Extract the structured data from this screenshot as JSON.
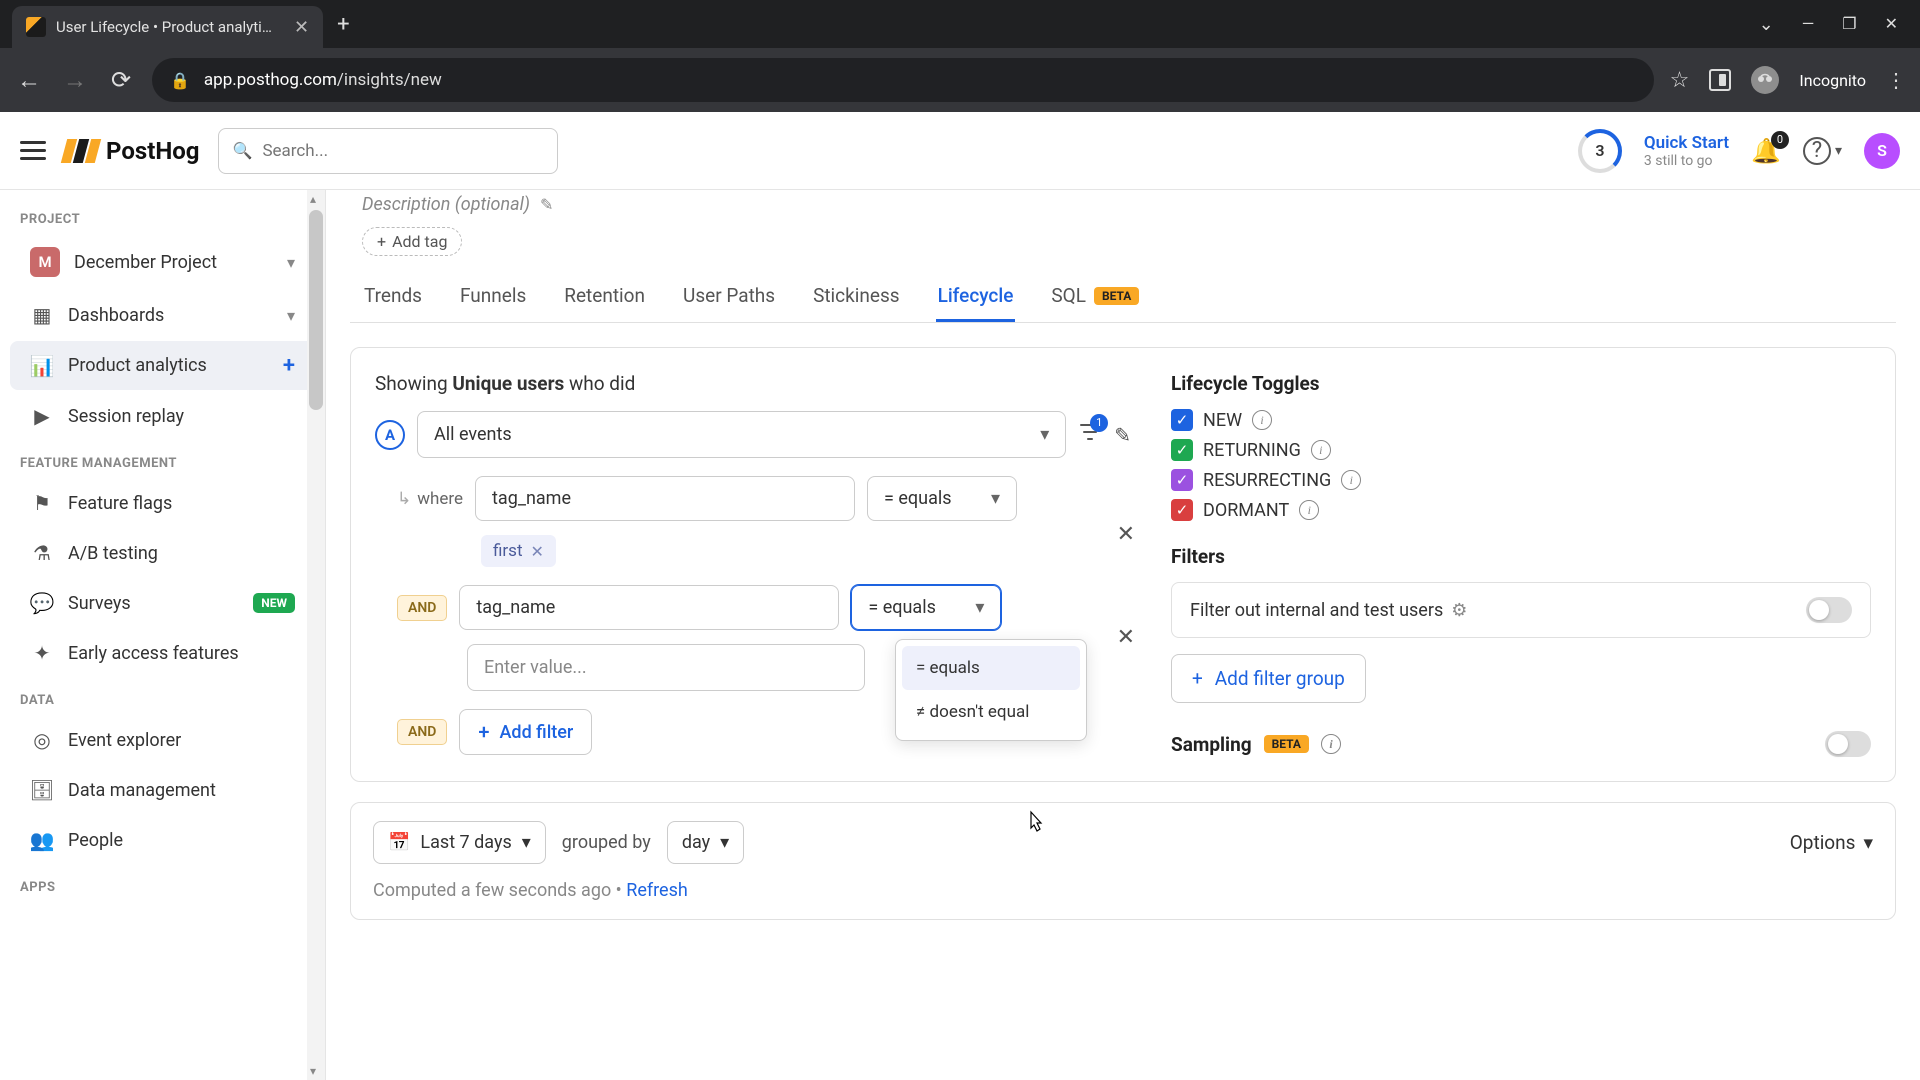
{
  "browser": {
    "tab_title": "User Lifecycle • Product analytics",
    "url_domain": "app.posthog.com",
    "url_path": "/insights/new",
    "incognito": "Incognito"
  },
  "header": {
    "brand": "PostHog",
    "search_placeholder": "Search...",
    "quick_start_title": "Quick Start",
    "quick_start_sub": "3 still to go",
    "ring_value": "3",
    "bell_count": "0",
    "user_initial": "S"
  },
  "sidebar": {
    "sections": {
      "project": "PROJECT",
      "feature": "FEATURE MANAGEMENT",
      "data": "DATA",
      "apps": "APPS"
    },
    "project_name": "December Project",
    "project_initial": "M",
    "items": {
      "dashboards": "Dashboards",
      "product_analytics": "Product analytics",
      "session_replay": "Session replay",
      "feature_flags": "Feature flags",
      "ab_testing": "A/B testing",
      "surveys": "Surveys",
      "early_access": "Early access features",
      "event_explorer": "Event explorer",
      "data_management": "Data management",
      "people": "People",
      "new_badge": "NEW"
    }
  },
  "main": {
    "description_placeholder": "Description (optional)",
    "add_tag": "Add tag",
    "tabs": {
      "trends": "Trends",
      "funnels": "Funnels",
      "retention": "Retention",
      "user_paths": "User Paths",
      "stickiness": "Stickiness",
      "lifecycle": "Lifecycle",
      "sql": "SQL",
      "beta": "BETA"
    },
    "showing_pre": "Showing ",
    "showing_bold": "Unique users",
    "showing_post": " who did",
    "step_letter": "A",
    "event_label": "All events",
    "filter_count": "1",
    "where": "where",
    "and": "AND",
    "prop1": "tag_name",
    "op1": "= equals",
    "chip1": "first",
    "prop2": "tag_name",
    "op2": "= equals",
    "value_placeholder": "Enter value...",
    "add_filter": "Add filter",
    "dropdown": {
      "equals": "= equals",
      "not_equals": "≠ doesn't equal"
    }
  },
  "right": {
    "toggles_title": "Lifecycle Toggles",
    "new": "NEW",
    "returning": "RETURNING",
    "resurrecting": "RESURRECTING",
    "dormant": "DORMANT",
    "filters_title": "Filters",
    "filter_out": "Filter out internal and test users",
    "add_filter_group": "Add filter group",
    "sampling": "Sampling",
    "beta": "BETA"
  },
  "bottom": {
    "date_range": "Last 7 days",
    "grouped_by": "grouped by",
    "interval": "day",
    "options": "Options",
    "computed": "Computed a few seconds ago • ",
    "refresh": "Refresh"
  }
}
